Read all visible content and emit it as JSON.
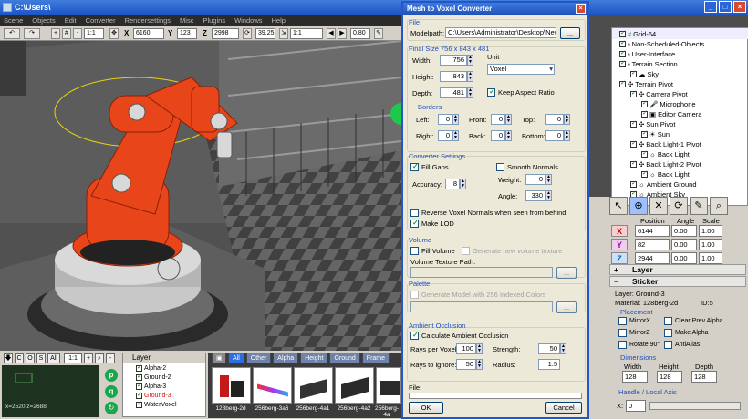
{
  "window": {
    "title": "C:\\Users\\",
    "minimize": "_",
    "maximize": "□",
    "close": "×"
  },
  "menu": [
    "Scene",
    "Objects",
    "Edit",
    "Converter",
    "Rendersettings",
    "Misc",
    "Plugins",
    "Windows",
    "Help"
  ],
  "toolbar": {
    "zoom": "1:1",
    "x_label": "X",
    "x_value": "6160",
    "y_label": "Y",
    "y_value": "123",
    "z_label": "Z",
    "z_value": "2998",
    "angle": "39.25",
    "range": "1:1",
    "opacity": "0.80"
  },
  "bottom": {
    "buttons": [
      "C",
      "O",
      "S",
      "All"
    ],
    "ratio": "1:1",
    "coords": "x=2520 z=2688",
    "layer_header": "Layer",
    "layers": [
      {
        "name": "Alpha-2",
        "checked": true
      },
      {
        "name": "Ground-2",
        "checked": true
      },
      {
        "name": "Alpha-3",
        "checked": true
      },
      {
        "name": "Ground-3",
        "checked": true
      },
      {
        "name": "WaterVoxel",
        "checked": true
      }
    ],
    "tabs": [
      "All",
      "Other",
      "Alpha",
      "Height",
      "Ground",
      "Frame"
    ],
    "thumbnails": [
      "128berg-2d",
      "256berg-3a6",
      "256berg-4a1",
      "256berg-4a2",
      "256berg-4a"
    ]
  },
  "dialog": {
    "title": "Mesh to Voxel Converter",
    "file_section": "File",
    "modelpath_label": "Modelpath:",
    "modelpath_value": "C:\\Users\\Administrator\\Desktop\\New",
    "browse": "...",
    "final_size": "Final Size 756 x 843 x 481",
    "width_label": "Width:",
    "width": "756",
    "height_label": "Height:",
    "height": "843",
    "depth_label": "Depth:",
    "depth": "481",
    "unit_label": "Unit",
    "unit": "Voxel",
    "keep_aspect": "Keep Aspect Ratio",
    "borders": "Borders",
    "left_label": "Left:",
    "left": "0",
    "front_label": "Front:",
    "front": "0",
    "top_label": "Top:",
    "top": "0",
    "right_label": "Right:",
    "right": "0",
    "back_label": "Back:",
    "back": "0",
    "bottom_label": "Bottom:",
    "bottom": "0",
    "converter_settings": "Converter Settings",
    "fill_gaps": "Fill Gaps",
    "smooth_normals": "Smooth Normals",
    "accuracy_label": "Accuracy:",
    "accuracy": "8",
    "weight_label": "Weight:",
    "weight": "0",
    "angle_label": "Angle:",
    "angle": "330",
    "reverse_normals": "Reverse Voxel Normals when seen from behind",
    "make_lod": "Make LOD",
    "volume": "Volume",
    "fill_volume": "Fill Volume",
    "generate_texture": "Generate new volume texture",
    "volume_texture_path": "Volume Texture Path:",
    "palette": "Palette",
    "indexed_colors": "Generate Model with 256 Indexed Colors",
    "ambient_occlusion": "Ambient Occlusion",
    "calc_ao": "Calculate Ambient Occlusion",
    "rays_label": "Rays per Voxel:",
    "rays": "100",
    "strength_label": "Strength:",
    "strength": "50",
    "ignore_label": "Rays to ignore:",
    "ignore": "50",
    "radius_label": "Radius:",
    "radius": "1.5",
    "file_label": "File:",
    "ok": "OK",
    "cancel": "Cancel"
  },
  "tree": [
    {
      "name": "Grid-64",
      "checked": true,
      "indent": 1
    },
    {
      "name": "Non-Scheduled-Objects",
      "checked": true,
      "indent": 1
    },
    {
      "name": "User-Interface",
      "checked": true,
      "indent": 1
    },
    {
      "name": "Terrain Section",
      "checked": true,
      "indent": 1
    },
    {
      "name": "Sky",
      "checked": true,
      "indent": 2
    },
    {
      "name": "Terrain Pivot",
      "checked": true,
      "indent": 1
    },
    {
      "name": "Camera Pivot",
      "checked": true,
      "indent": 2
    },
    {
      "name": "Microphone",
      "checked": true,
      "indent": 3
    },
    {
      "name": "Editor Camera",
      "checked": true,
      "indent": 3
    },
    {
      "name": "Sun Pivot",
      "checked": true,
      "indent": 2
    },
    {
      "name": "Sun",
      "checked": true,
      "indent": 3
    },
    {
      "name": "Back Light-1 Pivot",
      "checked": true,
      "indent": 2
    },
    {
      "name": "Back Light",
      "checked": true,
      "indent": 3
    },
    {
      "name": "Back Light-2 Pivot",
      "checked": true,
      "indent": 2
    },
    {
      "name": "Back Light",
      "checked": true,
      "indent": 3
    },
    {
      "name": "Ambient Ground",
      "checked": true,
      "indent": 2
    },
    {
      "name": "Ambient Sky",
      "checked": true,
      "indent": 2
    }
  ],
  "transform": {
    "headers": [
      "Position",
      "Angle",
      "Scale"
    ],
    "x": [
      "6144",
      "0.00",
      "1.00"
    ],
    "y": [
      "82",
      "0.00",
      "1.00"
    ],
    "z": [
      "2944",
      "0.00",
      "1.00"
    ]
  },
  "props": {
    "layer_header": "Layer",
    "sticker_header": "Sticker",
    "layer_line": "Layer:    Ground-3",
    "material_line": "Material: 128berg-2d",
    "id_line": "ID:5",
    "placement": "Placement",
    "mirror_x": "MirrorX",
    "mirror_z": "MirrorZ",
    "rotate": "Rotate 90°",
    "clear_alpha": "Clear Prev Alpha",
    "make_alpha": "Make Alpha",
    "antialias": "AntiAlias",
    "dimensions": "Dimensions",
    "dim_width_label": "Width",
    "dim_height_label": "Height",
    "dim_depth_label": "Depth",
    "dim_width": "128",
    "dim_height": "128",
    "dim_depth": "128",
    "handle": "Handle / Local Axis",
    "handle_x_label": "X:",
    "handle_x": "0"
  },
  "colors": {
    "accent": "#2e6de0",
    "robot": "#e8461a",
    "dialog_bg": "#ece9d8"
  }
}
